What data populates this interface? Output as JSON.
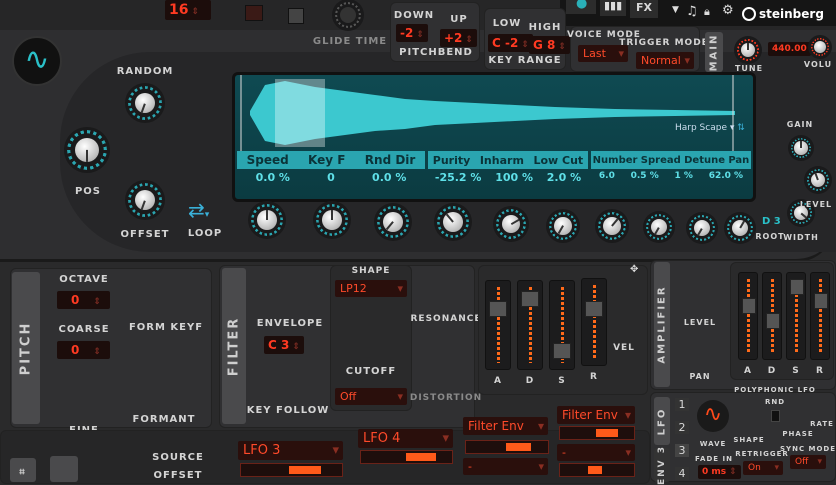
{
  "topbar": {
    "voices": "16",
    "glide_time": "Glide Time",
    "fx": "FX",
    "brand": "steinberg"
  },
  "pitchbend": {
    "label": "Pitchbend",
    "down_label": "Down",
    "down": "-2",
    "up_label": "Up",
    "up": "+2"
  },
  "key_range": {
    "label": "Key Range",
    "low_label": "Low",
    "low": "C -2",
    "high_label": "High",
    "high": "G 8"
  },
  "voice_mode": {
    "label": "Voice Mode",
    "value": "Last"
  },
  "trigger_mode": {
    "label": "Trigger Mode",
    "value": "Normal"
  },
  "main": {
    "tab": "MAIN",
    "tune_label": "Tune",
    "tune": "440.00",
    "volume_label": "Volu"
  },
  "grain": {
    "random": "Random",
    "pos": "Pos",
    "offset": "Offset",
    "loop": "Loop",
    "sample": "Harp Scape",
    "params": [
      {
        "name": "Speed",
        "value": "0.0 %"
      },
      {
        "name": "Key F",
        "value": "0"
      },
      {
        "name": "Rnd Dir",
        "value": "0.0 %"
      },
      {
        "name": "Purity",
        "value": "-25.2 %"
      },
      {
        "name": "Inharm",
        "value": "100 %"
      },
      {
        "name": "Low Cut",
        "value": "2.0 %"
      },
      {
        "name": "Number",
        "value": "6.0"
      },
      {
        "name": "Spread",
        "value": "0.5 %"
      },
      {
        "name": "Detune",
        "value": "1 %"
      },
      {
        "name": "Pan",
        "value": "62.0 %"
      }
    ],
    "root_value": "D 3",
    "root_label": "Root",
    "gain": "Gain",
    "level": "Level",
    "width": "Width"
  },
  "pitch": {
    "tab": "PITCH",
    "octave_label": "Octave",
    "octave": "0",
    "coarse_label": "Coarse",
    "coarse": "0",
    "fine": "Fine",
    "form_keyf": "Form KeyF",
    "formant": "Formant"
  },
  "filter": {
    "tab": "FILTER",
    "envelope": "Envelope",
    "key_value": "C 3",
    "key_follow": "Key Follow",
    "shape_label": "Shape",
    "shape": "LP12",
    "cutoff": "Cutoff",
    "mode": "Off",
    "resonance": "Resonance",
    "distortion": "Distortion",
    "vel": "Vel",
    "adsr": [
      "A",
      "D",
      "S",
      "R"
    ]
  },
  "amplifier": {
    "tab": "AMPLIFIER",
    "level": "Level",
    "pan": "Pan",
    "adsr": [
      "A",
      "D",
      "S",
      "R"
    ]
  },
  "mod": {
    "source": "Source",
    "offset": "Offset",
    "slots": [
      "LFO 3",
      "LFO 4",
      "Filter Env",
      "Filter Env"
    ],
    "dash": "-"
  },
  "lfo": {
    "tab": "LFO",
    "env_tab": "ENV 3",
    "nums": [
      "1",
      "2",
      "3",
      "4"
    ],
    "title": "Polyphonic LFO",
    "wave": "Wave",
    "shape": "Shape",
    "rnd": "RND",
    "phase": "Phase",
    "rate": "Rate",
    "fade_in_label": "Fade In",
    "fade_in": "0 ms",
    "retrigger_label": "Retrigger",
    "retrigger": "On",
    "sync_label": "Sync Mode",
    "sync": "Off"
  },
  "colors": {
    "teal": "#2aa5b0",
    "red": "#ff3a22",
    "orange": "#ff5a1a"
  }
}
